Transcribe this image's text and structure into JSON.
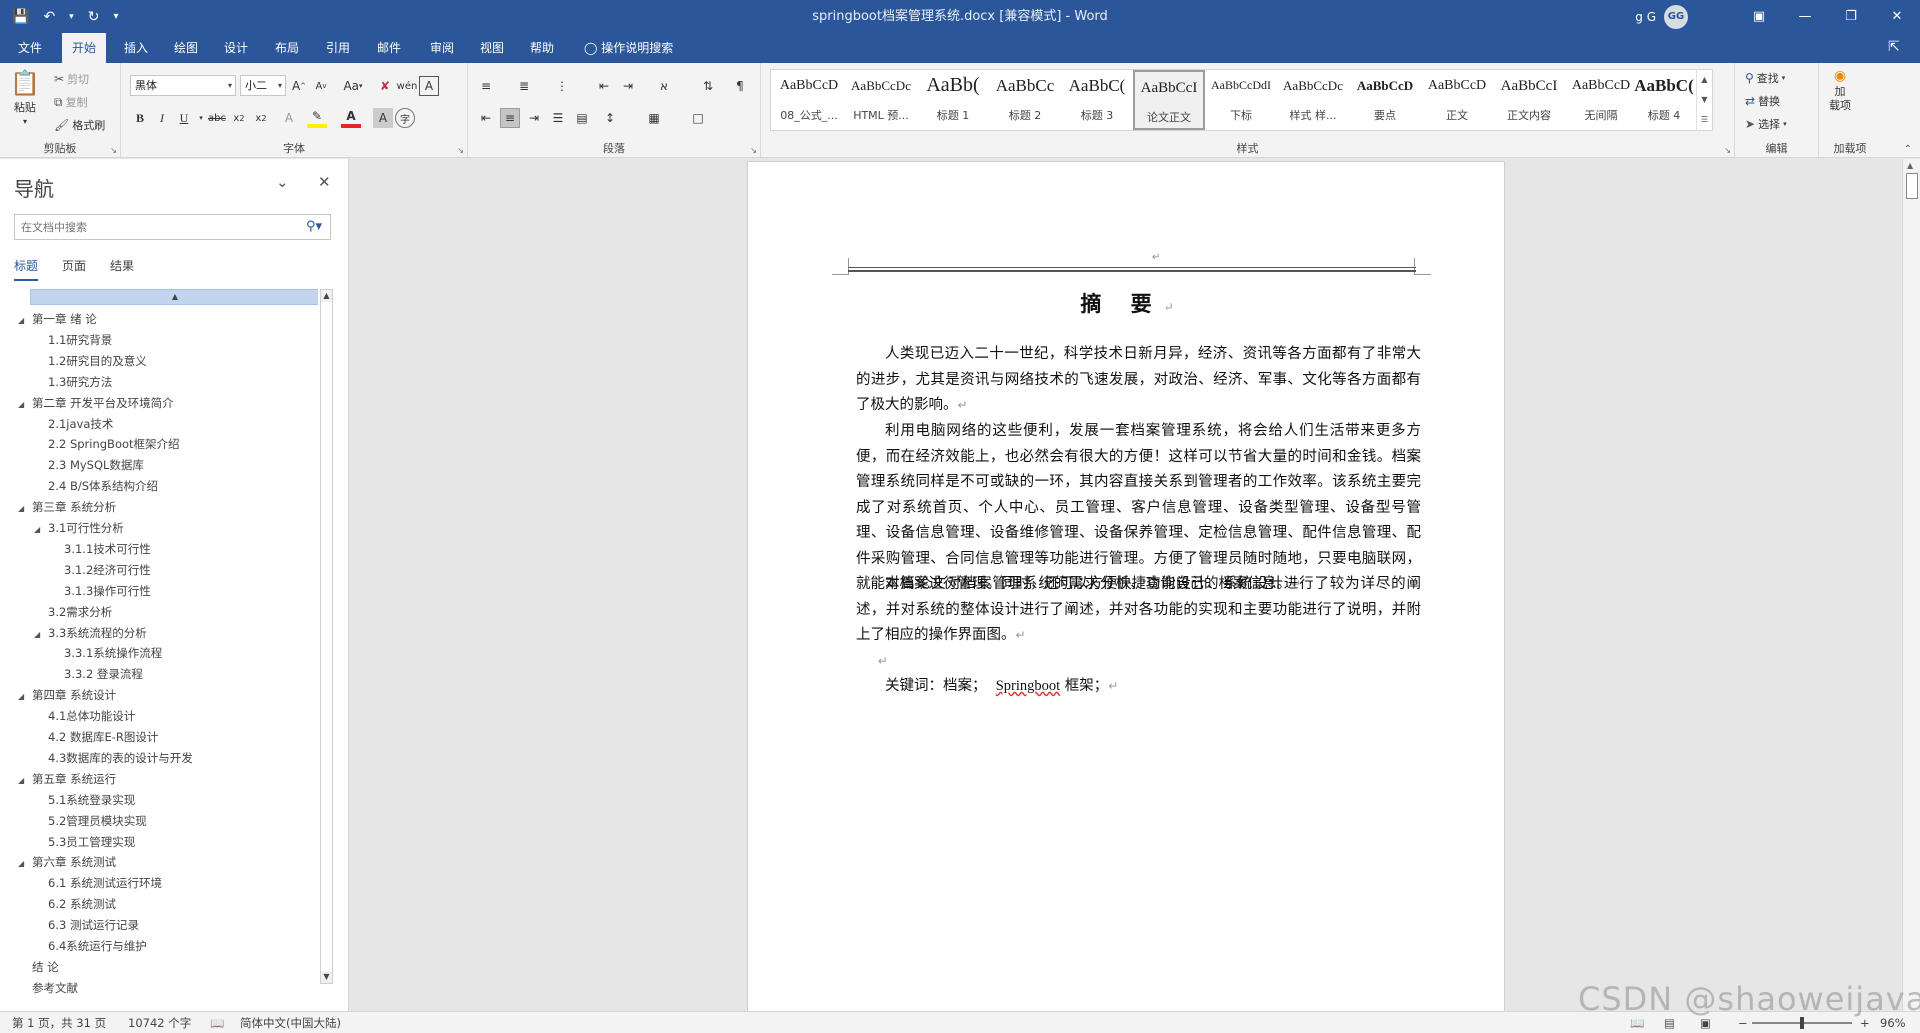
{
  "window": {
    "title": "springboot档案管理系统.docx [兼容模式] - Word",
    "user_name": "g G",
    "user_initials": "GG"
  },
  "menu": {
    "tabs": [
      "文件",
      "开始",
      "插入",
      "绘图",
      "设计",
      "布局",
      "引用",
      "邮件",
      "审阅",
      "视图",
      "帮助"
    ],
    "active": "开始",
    "tell_me": "操作说明搜索"
  },
  "ribbon": {
    "clipboard": {
      "label": "剪贴板",
      "paste": "粘贴",
      "cut": "剪切",
      "copy": "复制",
      "format_painter": "格式刷"
    },
    "font": {
      "label": "字体",
      "family": "黑体",
      "size": "小二",
      "case": "Aa"
    },
    "paragraph": {
      "label": "段落"
    },
    "styles": {
      "label": "样式",
      "items": [
        {
          "sample": "AaBbCcD",
          "name": "08_公式_..."
        },
        {
          "sample": "AaBbCcDc",
          "name": "HTML 预..."
        },
        {
          "sample": "AaBb(",
          "name": "标题 1"
        },
        {
          "sample": "AaBbCc",
          "name": "标题 2"
        },
        {
          "sample": "AaBbC(",
          "name": "标题 3"
        },
        {
          "sample": "AaBbCcI",
          "name": "论文正文"
        },
        {
          "sample": "AaBbCcDdI",
          "name": "下标"
        },
        {
          "sample": "AaBbCcDc",
          "name": "样式 样..."
        },
        {
          "sample": "AaBbCcD",
          "name": "要点"
        },
        {
          "sample": "AaBbCcD",
          "name": "正文"
        },
        {
          "sample": "AaBbCcI",
          "name": "正文内容"
        },
        {
          "sample": "AaBbCcD",
          "name": "无间隔"
        },
        {
          "sample": "AaBbC(",
          "name": "标题 4"
        }
      ],
      "selected_index": 5
    },
    "editing": {
      "label": "编辑",
      "find": "查找",
      "replace": "替换",
      "select": "选择"
    },
    "addins": {
      "label": "加载项",
      "button": "加\n载项"
    }
  },
  "nav": {
    "title": "导航",
    "search_placeholder": "在文档中搜索",
    "tabs": [
      "标题",
      "页面",
      "结果"
    ],
    "active_tab": "标题",
    "items": [
      {
        "level": 1,
        "text": "第一章 绪  论",
        "collapsible": true
      },
      {
        "level": 2,
        "text": "1.1研究背景",
        "collapsible": false
      },
      {
        "level": 2,
        "text": "1.2研究目的及意义",
        "collapsible": false
      },
      {
        "level": 2,
        "text": "1.3研究方法",
        "collapsible": false
      },
      {
        "level": 1,
        "text": "第二章 开发平台及环境简介",
        "collapsible": true
      },
      {
        "level": 2,
        "text": "2.1java技术",
        "collapsible": false
      },
      {
        "level": 2,
        "text": "2.2 SpringBoot框架介绍",
        "collapsible": false
      },
      {
        "level": 2,
        "text": "2.3 MySQL数据库",
        "collapsible": false
      },
      {
        "level": 2,
        "text": "2.4 B/S体系结构介绍",
        "collapsible": false
      },
      {
        "level": 1,
        "text": "第三章 系统分析",
        "collapsible": true
      },
      {
        "level": 2,
        "text": "3.1可行性分析",
        "collapsible": true
      },
      {
        "level": 3,
        "text": "3.1.1技术可行性",
        "collapsible": false
      },
      {
        "level": 3,
        "text": "3.1.2经济可行性",
        "collapsible": false
      },
      {
        "level": 3,
        "text": "3.1.3操作可行性",
        "collapsible": false
      },
      {
        "level": 2,
        "text": "3.2需求分析",
        "collapsible": false
      },
      {
        "level": 2,
        "text": "3.3系统流程的分析",
        "collapsible": true
      },
      {
        "level": 3,
        "text": "3.3.1系统操作流程",
        "collapsible": false
      },
      {
        "level": 3,
        "text": "3.3.2 登录流程",
        "collapsible": false
      },
      {
        "level": 1,
        "text": "第四章 系统设计",
        "collapsible": true
      },
      {
        "level": 2,
        "text": "4.1总体功能设计",
        "collapsible": false
      },
      {
        "level": 2,
        "text": "4.2 数据库E-R图设计",
        "collapsible": false
      },
      {
        "level": 2,
        "text": "4.3数据库的表的设计与开发",
        "collapsible": false
      },
      {
        "level": 1,
        "text": "第五章 系统运行",
        "collapsible": true
      },
      {
        "level": 2,
        "text": "5.1系统登录实现",
        "collapsible": false
      },
      {
        "level": 2,
        "text": "5.2管理员模块实现",
        "collapsible": false
      },
      {
        "level": 2,
        "text": "5.3员工管理实现",
        "collapsible": false
      },
      {
        "level": 1,
        "text": "第六章 系统测试",
        "collapsible": true
      },
      {
        "level": 2,
        "text": "6.1 系统测试运行环境",
        "collapsible": false
      },
      {
        "level": 2,
        "text": "6.2 系统测试",
        "collapsible": false
      },
      {
        "level": 2,
        "text": "6.3 测试运行记录",
        "collapsible": false
      },
      {
        "level": 2,
        "text": "6.4系统运行与维护",
        "collapsible": false
      },
      {
        "level": 1,
        "text": "结  论",
        "collapsible": false
      },
      {
        "level": 1,
        "text": "参考文献",
        "collapsible": false
      }
    ]
  },
  "document": {
    "heading": "摘  要",
    "paragraphs": [
      "人类现已迈入二十一世纪，科学技术日新月异，经济、资讯等各方面都有了非常大的进步，尤其是资讯与网络技术的飞速发展，对政治、经济、军事、文化等各方面都有了极大的影响。",
      "利用电脑网络的这些便利，发展一套档案管理系统，将会给人们生活带来更多方便，而在经济效能上，也必然会有很大的方便！这样可以节省大量的时间和金钱。档案管理系统同样是不可或缺的一环，其内容直接关系到管理者的工作效率。该系统主要完成了对系统首页、个人中心、员工管理、客户信息管理、设备类型管理、设备型号管理、设备信息管理、设备维修管理、设备保养管理、定检信息管理、配件信息管理、配件采购管理、合同信息管理等功能进行管理。方便了管理员随时随地，只要电脑联网，就能对档案进行管理。同时，还可以方便快捷查询自己的档案信息。",
      "本篇论文对档案管理系统的需求分析、功能设计、系统设计进行了较为详尽的阐述，并对系统的整体设计进行了阐述，并对各功能的实现和主要功能进行了说明，并附上了相应的操作界面图。"
    ],
    "keywords_label": "关键词：",
    "keywords_1": "档案；",
    "keywords_brand": "Springboot",
    "keywords_2": "框架；",
    "para_mark": "↵"
  },
  "status": {
    "page": "第 1 页，共 31 页",
    "words": "10742 个字",
    "language": "简体中文(中国大陆)",
    "zoom": "96%"
  },
  "watermark": "CSDN @shaoweijava",
  "colors": {
    "accent": "#2b579a"
  }
}
